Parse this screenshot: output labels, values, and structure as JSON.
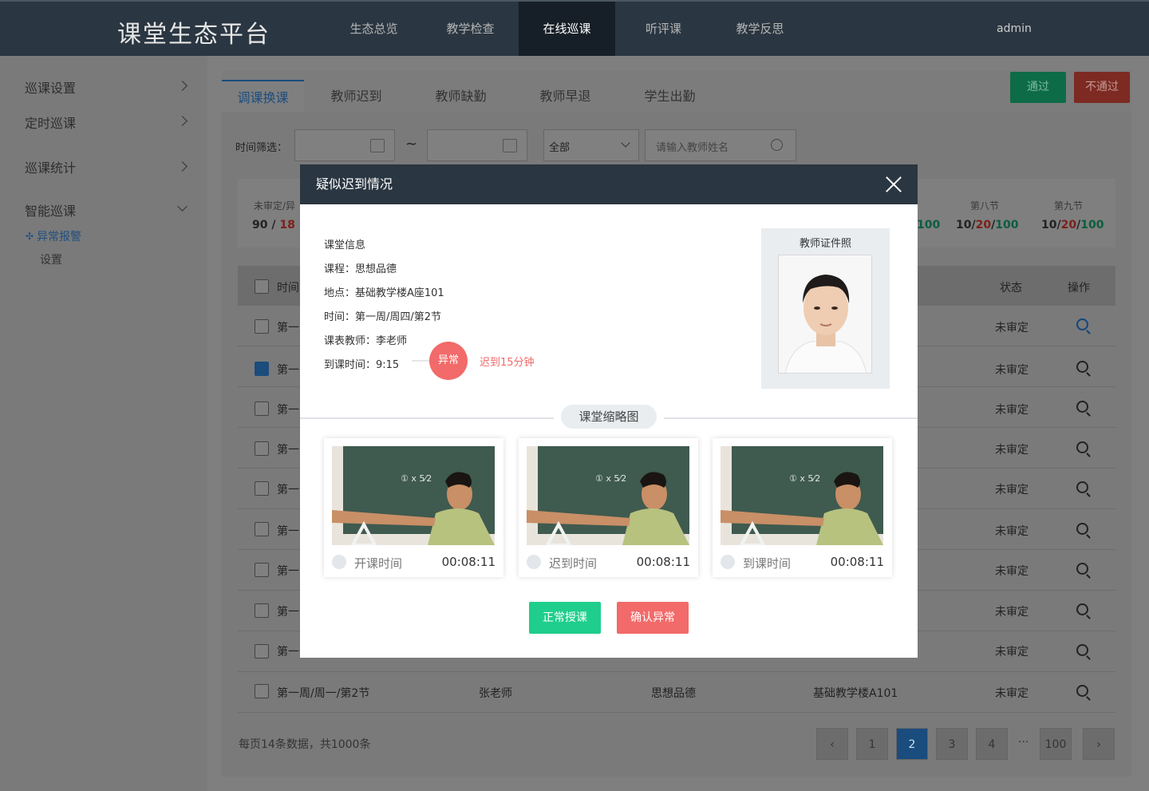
{
  "header": {
    "logo": "课堂生态平台",
    "nav": [
      "生态总览",
      "教学检查",
      "在线巡课",
      "听评课",
      "教学反思"
    ],
    "user": "admin"
  },
  "sidebar": {
    "items": [
      "巡课设置",
      "定时巡课",
      "巡课统计",
      "智能巡课"
    ],
    "sub_active": "异常报警",
    "sub_item": "设置"
  },
  "tabs": [
    "调课换课",
    "教师迟到",
    "教师缺勤",
    "教师早退",
    "学生出勤"
  ],
  "actions": {
    "pass": "通过",
    "fail": "不通过"
  },
  "filter": {
    "label": "时间筛选：",
    "tilde": "~",
    "select": "全部",
    "search_placeholder": "请输入教师姓名"
  },
  "stats": {
    "left_label": "未审定/异",
    "left_val_a": "90 / ",
    "left_val_b": "18",
    "s8_label": "第八节",
    "s9_label": "第九节",
    "partial_100": "100",
    "s8": {
      "a": "10",
      "b": "20",
      "c": "100"
    },
    "s9": {
      "a": "10",
      "b": "20",
      "c": "100"
    },
    "sep": "/"
  },
  "table": {
    "col_time": "时间",
    "col_status": "状态",
    "col_op": "操作",
    "rows": [
      {
        "time": "第一",
        "status": "未审定"
      },
      {
        "time": "第一",
        "status": "未审定"
      },
      {
        "time": "第一",
        "status": "未审定"
      },
      {
        "time": "第一",
        "status": "未审定"
      },
      {
        "time": "第一",
        "status": "未审定"
      },
      {
        "time": "第一",
        "status": "未审定"
      },
      {
        "time": "第一",
        "status": "未审定"
      },
      {
        "time": "第一",
        "status": "未审定"
      },
      {
        "time": "第一",
        "status": "未审定"
      }
    ],
    "last_row": {
      "time": "第一周/周一/第2节",
      "teacher": "张老师",
      "course": "思想品德",
      "place": "基础教学楼A101",
      "status": "未审定"
    }
  },
  "footer": {
    "summary": "每页14条数据，共1000条",
    "pages": [
      "1",
      "2",
      "3",
      "4",
      "···",
      "100"
    ],
    "current": "2"
  },
  "modal": {
    "title": "疑似迟到情况",
    "info_title": "课堂信息",
    "course": "课程：思想品德",
    "place": "地点：基础教学楼A座101",
    "time": "时间：第一周/周四/第2节",
    "teacher": "课表教师：李老师",
    "arrive": "到课时间：9:15",
    "badge": "异常",
    "late": "迟到15分钟",
    "id_title": "教师证件照",
    "thumb_title": "课堂缩略图",
    "thumbs": [
      {
        "label": "开课时间",
        "time": "00:08:11"
      },
      {
        "label": "迟到时间",
        "time": "00:08:11"
      },
      {
        "label": "到课时间",
        "time": "00:08:11"
      }
    ],
    "btn_normal": "正常授课",
    "btn_confirm": "确认异常"
  },
  "colors": {
    "accent": "#1a4c7d",
    "green": "#1fce8c",
    "red": "#f26a69",
    "header": "#2a3641"
  }
}
